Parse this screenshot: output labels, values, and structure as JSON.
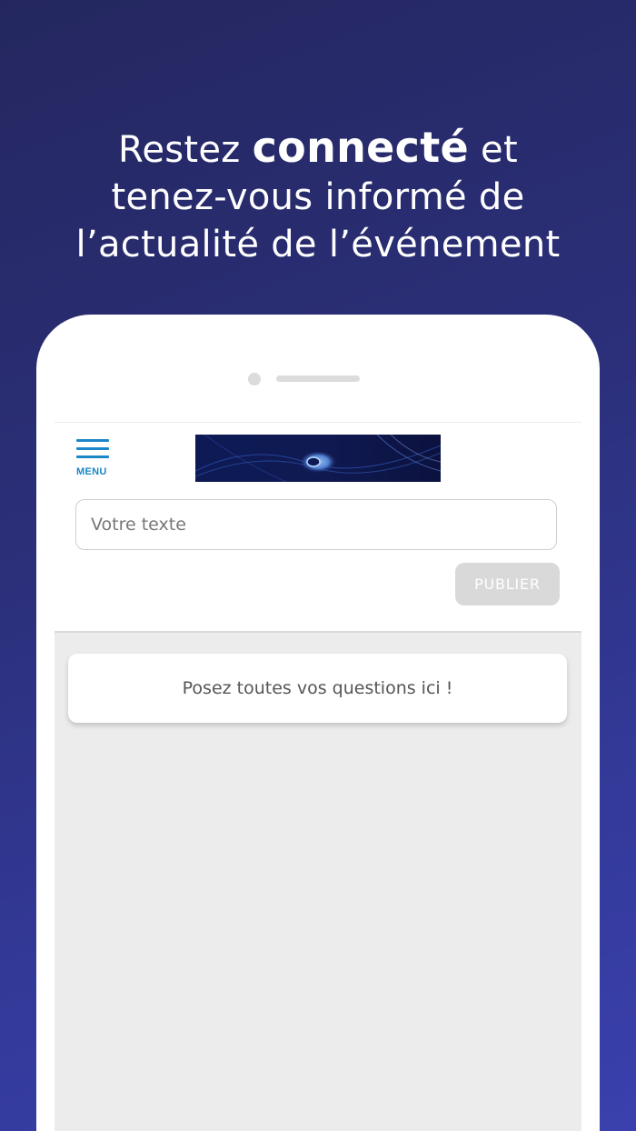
{
  "headline": {
    "line1_before": "Restez ",
    "line1_bold": "connecté",
    "line1_after": " et",
    "line2": "tenez-vous informé de",
    "line3": "l’actualité de l’événement"
  },
  "app": {
    "menu_label": "MENU",
    "input_placeholder": "Votre texte",
    "publish_label": "PUBLIER",
    "notice_text": "Posez toutes vos questions ici !"
  },
  "colors": {
    "background_gradient": [
      "#24275f",
      "#3a40ad"
    ],
    "accent": "#1b86c8",
    "publish_disabled": "#d9d9d9",
    "feed_background": "#ececec"
  },
  "icons": {
    "menu": "hamburger-menu-icon"
  }
}
